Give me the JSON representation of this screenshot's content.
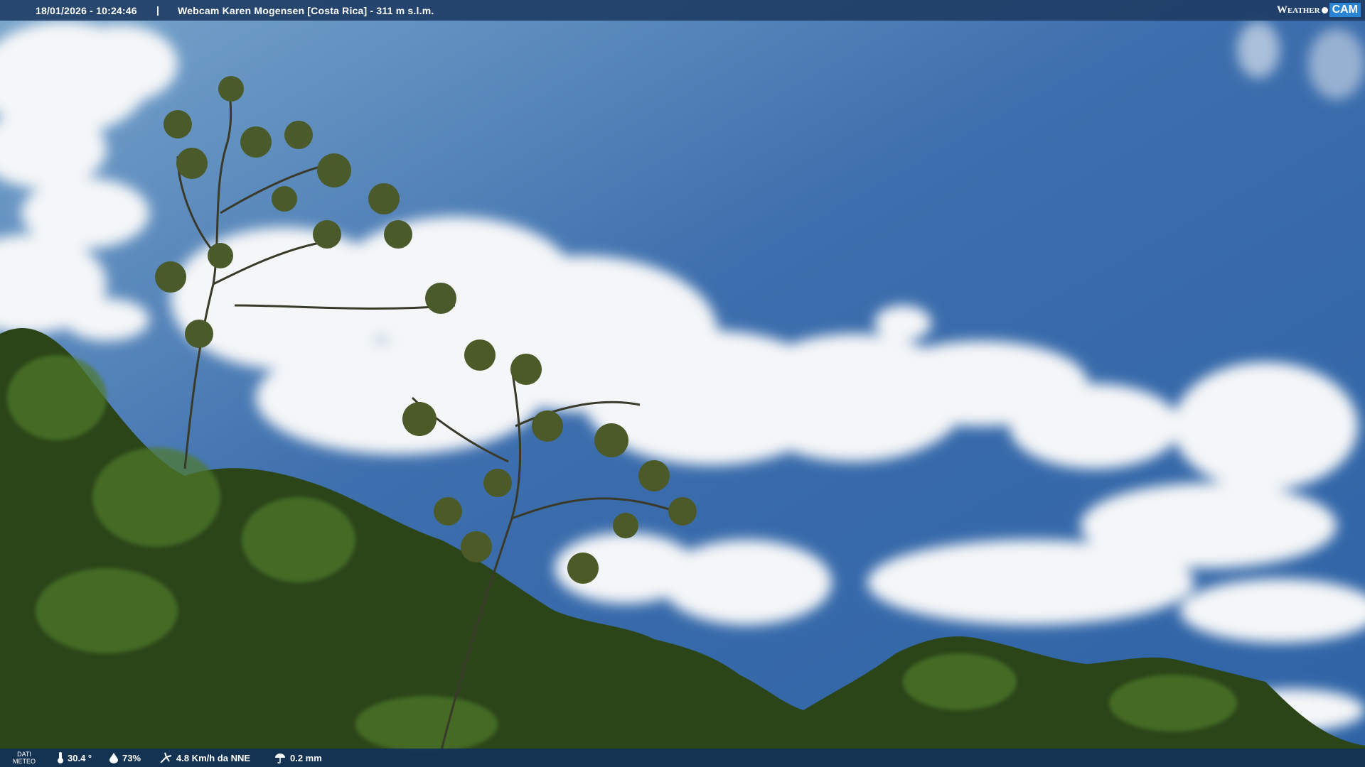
{
  "header": {
    "timestamp": "18/01/2026 - 10:24:46",
    "separator": "|",
    "location": "Webcam Karen Mogensen [Costa Rica]  - 311 m s.l.m.",
    "brand_weather": "Weather",
    "brand_cam": "CAM"
  },
  "footer": {
    "dati_line1": "DATI",
    "dati_line2": "METEO",
    "temperature": "30.4 °",
    "humidity": "73%",
    "wind": "4.8 Km/h da NNE",
    "rain": "0.2 mm",
    "icons": [
      "thermometer-icon",
      "humidity-drop-icon",
      "wind-icon",
      "rain-icon"
    ]
  },
  "colors": {
    "sky_top": "#6f9bc4",
    "sky_mid": "#3566a6",
    "sky_deep": "#2a5a9a",
    "bar_bg": "#1c3a62",
    "foliage": "#2f4a1c"
  }
}
